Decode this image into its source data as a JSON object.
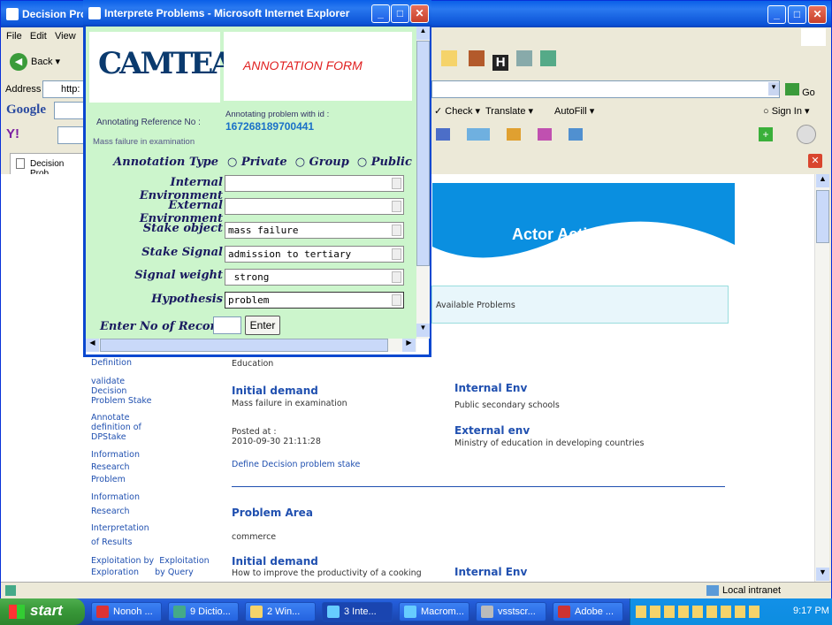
{
  "main_window": {
    "title": "Decision Pro",
    "menu": [
      "File",
      "Edit",
      "View"
    ],
    "toolbar": {
      "back": "Back"
    },
    "address": {
      "label": "Address",
      "value": "http:",
      "go": "Go"
    },
    "google": {
      "logo": "Google",
      "check": "Check",
      "translate": "Translate",
      "autofill": "AutoFill",
      "sign_in": "Sign In"
    },
    "tab": "Decision Prob",
    "status": "Local intranet"
  },
  "page": {
    "banner_title": "Actor Action Simulation",
    "available_problems": "Available Problems",
    "sidebar": [
      {
        "id": "definition",
        "label": "Definition"
      },
      {
        "id": "validate",
        "label": "validate\nDecision\nProblem Stake"
      },
      {
        "id": "annotate",
        "label": "Annotate\ndefinition of\nDPStake"
      },
      {
        "id": "info-research-problem",
        "label": "Information\nResearch\nProblem"
      },
      {
        "id": "info-research",
        "label": "Information\nResearch"
      },
      {
        "id": "interpretation",
        "label": "Interpretation\nof Results"
      },
      {
        "id": "exploitation",
        "label": "Exploitation by  Exploitation\nExploration      by Query"
      }
    ],
    "record1": {
      "area": "Education",
      "initial_demand_label": "Initial demand",
      "initial_demand": "Mass failure in examination",
      "posted_label": "Posted at :",
      "posted_at": "2010-09-30 21:11:28",
      "define_link": "Define Decision problem stake",
      "internal_env_label": "Internal Env",
      "internal_env": "Public secondary schools",
      "external_env_label": "External env",
      "external_env": "Ministry of education in developing countries"
    },
    "record2": {
      "area_label": "Problem Area",
      "area": "commerce",
      "initial_demand_label": "Initial demand",
      "initial_demand": "How to improve the productivity of a cooking",
      "internal_env_label": "Internal Env"
    }
  },
  "popup": {
    "title": "Interprete Problems - Microsoft Internet Explorer",
    "logo": "CAMTEA",
    "form_title": "ANNOTATION FORM",
    "ref_label": "Annotating Reference No :",
    "problem_label": "Annotating problem with id :",
    "problem_id": "167268189700441",
    "problem_desc": "Mass failure in examination",
    "annotation_type_label": "Annotation Type",
    "annotation_types": [
      "Private",
      "Group",
      "Public"
    ],
    "fields": [
      {
        "label": "Internal Environment",
        "value": ""
      },
      {
        "label": "External Environment",
        "value": ""
      },
      {
        "label": "Stake object",
        "value": "mass failure"
      },
      {
        "label": "Stake Signal",
        "value": "admission to tertiary"
      },
      {
        "label": "Signal weight",
        "value": " strong"
      },
      {
        "label": "Hypothesis",
        "value": "problem"
      }
    ],
    "records_label": "Enter No of Records:",
    "enter_button": "Enter"
  },
  "taskbar": {
    "start": "start",
    "tasks": [
      "Nonoh ...",
      "9 Dictio...",
      "2 Win...",
      "3 Inte...",
      "Macrom...",
      "vsstscr...",
      "Adobe ..."
    ],
    "clock": "9:17 PM"
  }
}
